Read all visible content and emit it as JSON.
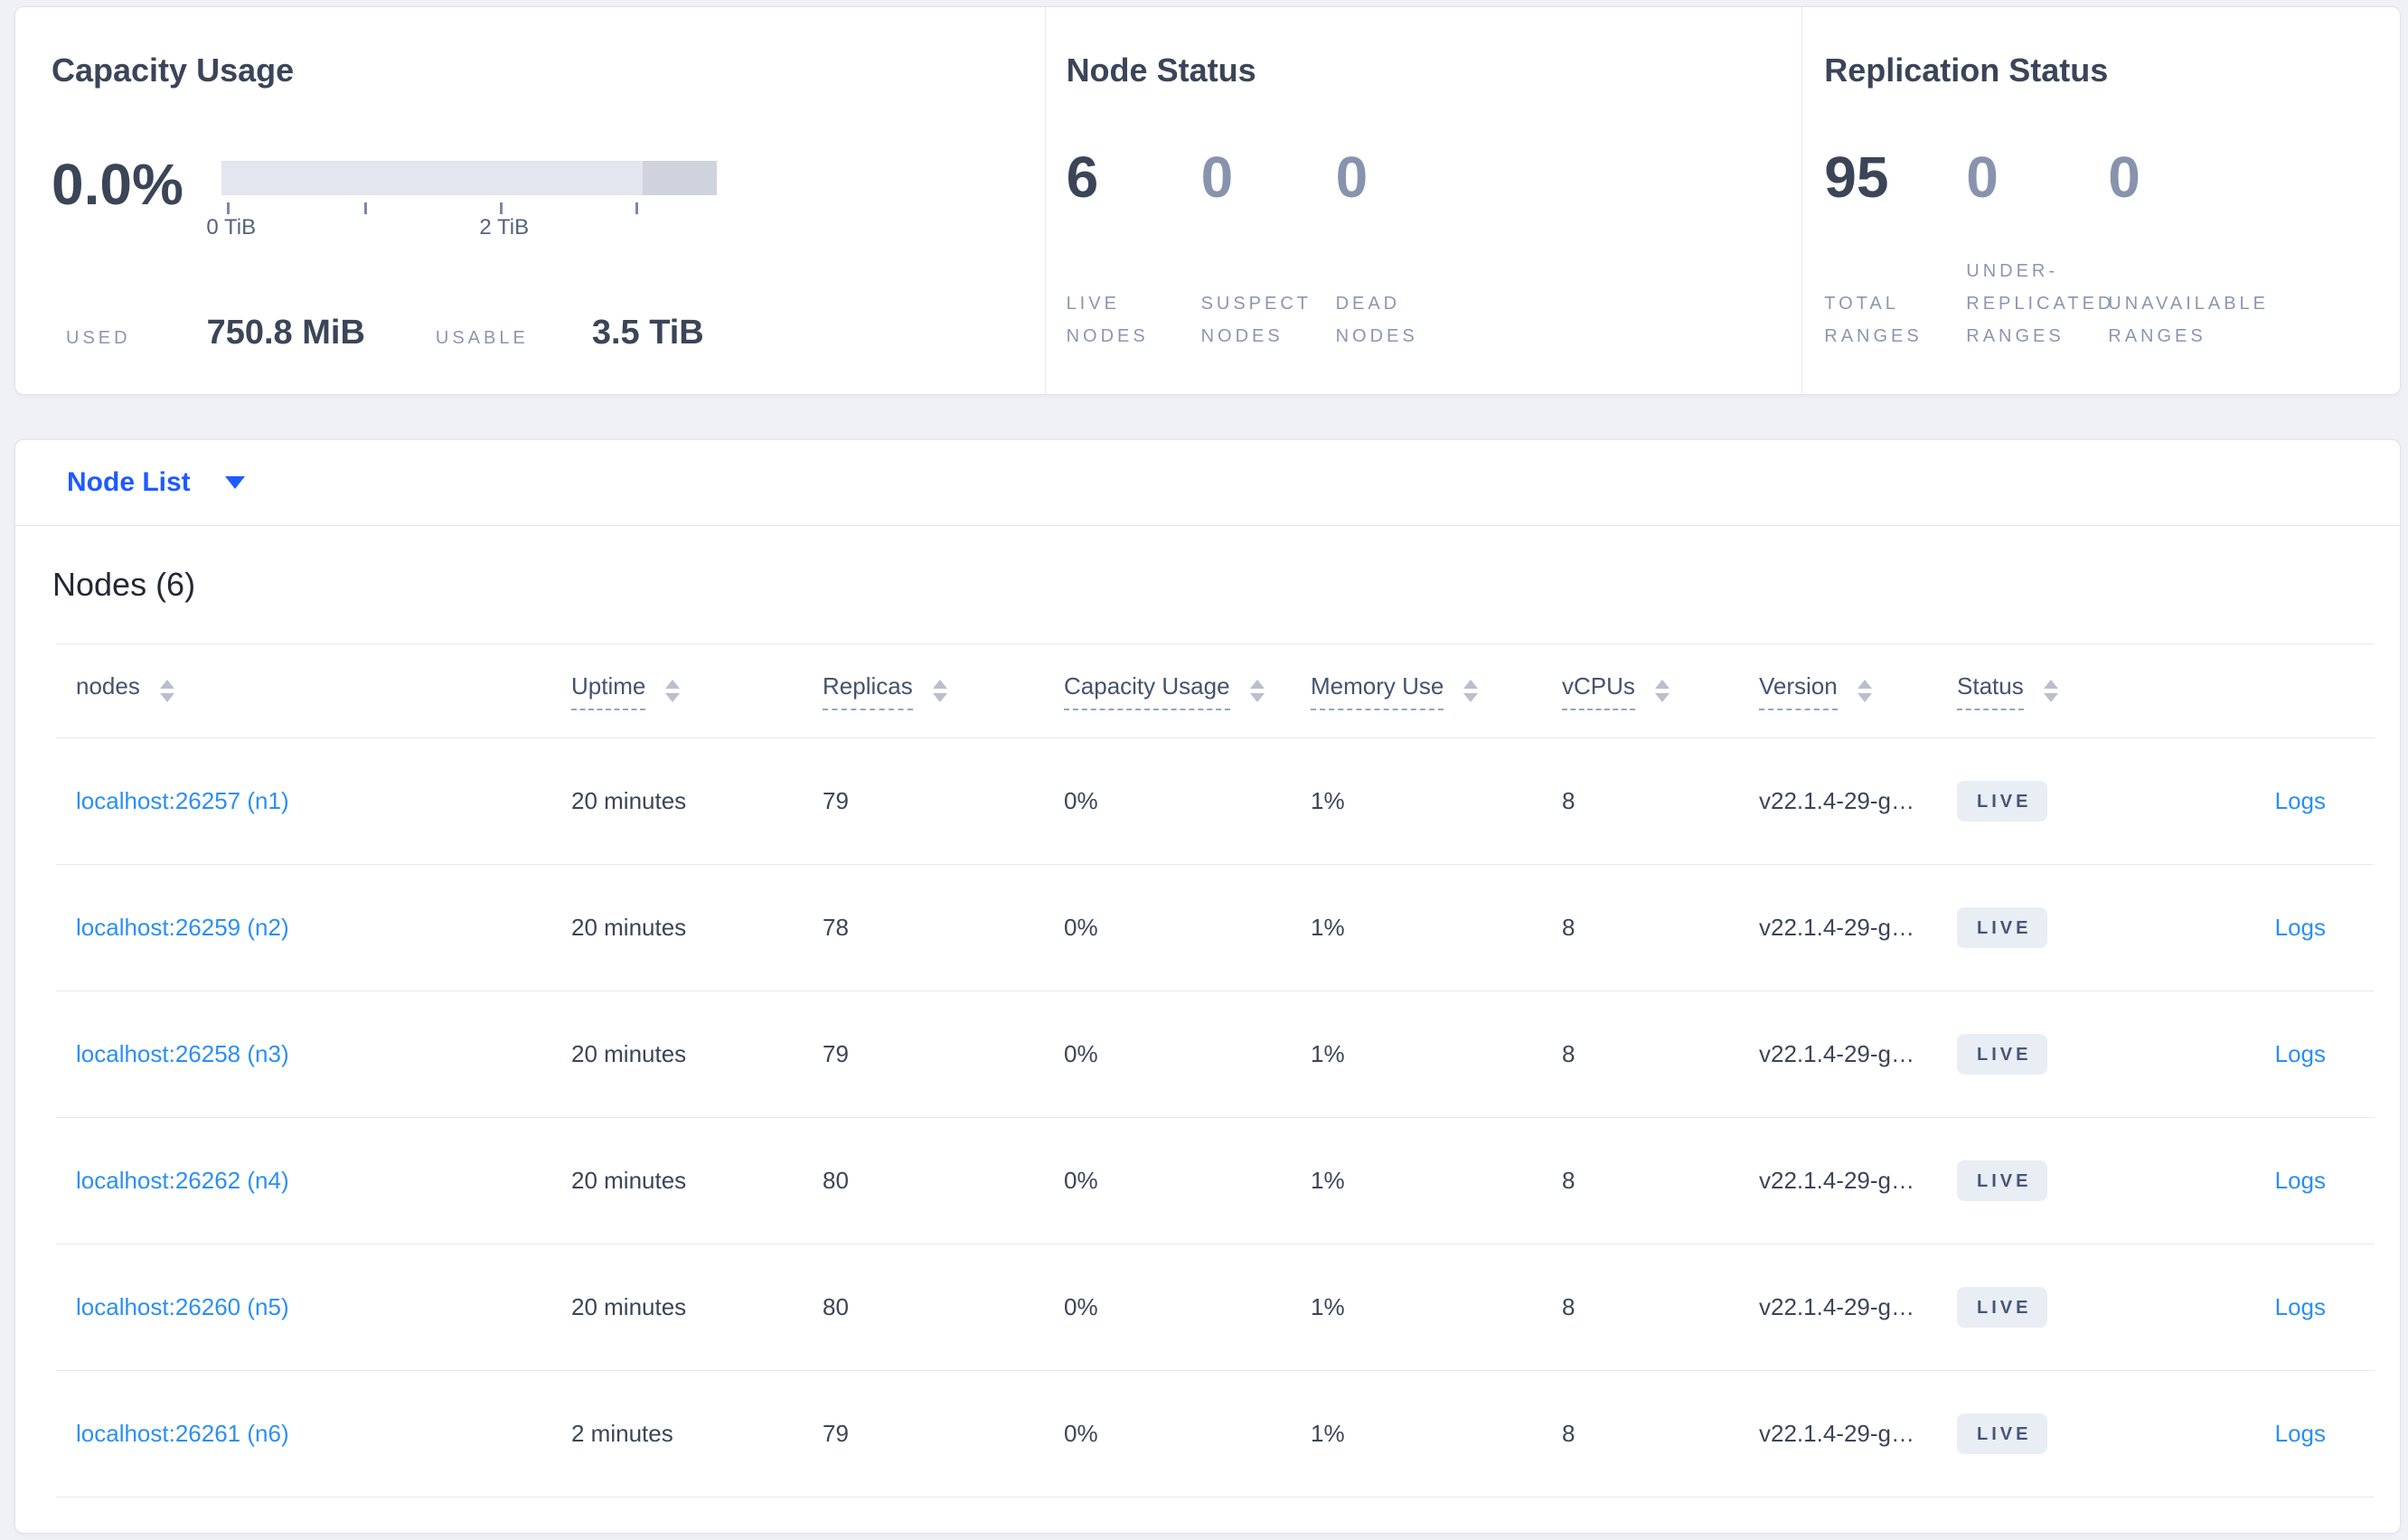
{
  "colors": {
    "page_bg": "#eff1f7",
    "accent_blue": "#1e5bff",
    "link_blue": "#2b8ff2",
    "dark_slate": "#3b4558",
    "dim_number": "#8893ae",
    "label_gray": "#8b96b0",
    "badge_bg": "#e9edf4",
    "bar_light": "#e3e6ef",
    "bar_dark": "#ced3de"
  },
  "capacity": {
    "title": "Capacity Usage",
    "percent": "0.0%",
    "tick_0": "0 TiB",
    "tick_2": "2 TiB",
    "used_label": "USED",
    "used_value": "750.8 MiB",
    "usable_label": "USABLE",
    "usable_value": "3.5 TiB"
  },
  "node_status": {
    "title": "Node Status",
    "stats": [
      {
        "value": "6",
        "l1": "LIVE",
        "l2": "NODES"
      },
      {
        "value": "0",
        "l1": "SUSPECT",
        "l2": "NODES"
      },
      {
        "value": "0",
        "l1": "DEAD",
        "l2": "NODES"
      }
    ]
  },
  "replication": {
    "title": "Replication Status",
    "stats": [
      {
        "value": "95",
        "l1": "TOTAL",
        "l2": "RANGES"
      },
      {
        "value": "0",
        "l1": "UNDER-",
        "l2": "REPLICATED",
        "l3": "RANGES"
      },
      {
        "value": "0",
        "l1": "UNAVAILABLE",
        "l2": "RANGES"
      }
    ]
  },
  "node_list": {
    "label": "Node List"
  },
  "table": {
    "heading": "Nodes (6)",
    "columns": [
      {
        "label": "nodes"
      },
      {
        "label": "Uptime"
      },
      {
        "label": "Replicas"
      },
      {
        "label": "Capacity Usage"
      },
      {
        "label": "Memory Use"
      },
      {
        "label": "vCPUs"
      },
      {
        "label": "Version"
      },
      {
        "label": "Status"
      }
    ],
    "rows": [
      {
        "address": "localhost:26257 (n1)",
        "uptime": "20 minutes",
        "replicas": "79",
        "capacity": "0%",
        "memory": "1%",
        "vcpus": "8",
        "version": "v22.1.4-29-g…",
        "status": "LIVE",
        "logs": "Logs"
      },
      {
        "address": "localhost:26259 (n2)",
        "uptime": "20 minutes",
        "replicas": "78",
        "capacity": "0%",
        "memory": "1%",
        "vcpus": "8",
        "version": "v22.1.4-29-g…",
        "status": "LIVE",
        "logs": "Logs"
      },
      {
        "address": "localhost:26258 (n3)",
        "uptime": "20 minutes",
        "replicas": "79",
        "capacity": "0%",
        "memory": "1%",
        "vcpus": "8",
        "version": "v22.1.4-29-g…",
        "status": "LIVE",
        "logs": "Logs"
      },
      {
        "address": "localhost:26262 (n4)",
        "uptime": "20 minutes",
        "replicas": "80",
        "capacity": "0%",
        "memory": "1%",
        "vcpus": "8",
        "version": "v22.1.4-29-g…",
        "status": "LIVE",
        "logs": "Logs"
      },
      {
        "address": "localhost:26260 (n5)",
        "uptime": "20 minutes",
        "replicas": "80",
        "capacity": "0%",
        "memory": "1%",
        "vcpus": "8",
        "version": "v22.1.4-29-g…",
        "status": "LIVE",
        "logs": "Logs"
      },
      {
        "address": "localhost:26261 (n6)",
        "uptime": "2 minutes",
        "replicas": "79",
        "capacity": "0%",
        "memory": "1%",
        "vcpus": "8",
        "version": "v22.1.4-29-g…",
        "status": "LIVE",
        "logs": "Logs"
      }
    ]
  }
}
